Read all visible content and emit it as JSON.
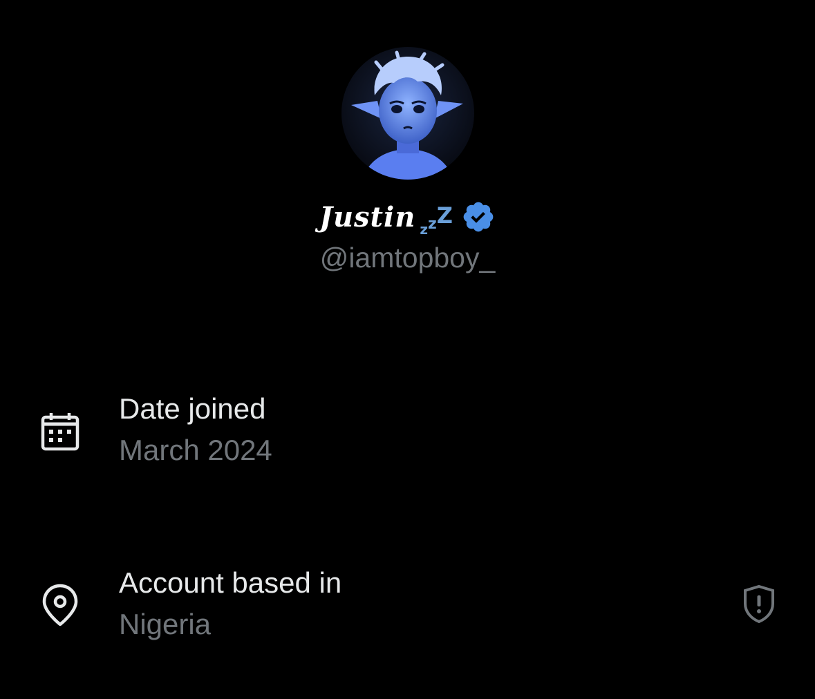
{
  "profile": {
    "display_name": "Justin",
    "name_suffix_emoji": [
      "z",
      "z",
      "Z"
    ],
    "handle": "@iamtopboy_",
    "verified": true,
    "avatar_icon": "avatar-illustration",
    "verified_color": "#4a8fe7"
  },
  "info": {
    "date_joined": {
      "label": "Date joined",
      "value": "March 2024",
      "icon": "calendar-icon"
    },
    "account_location": {
      "label": "Account based in",
      "value": "Nigeria",
      "icon": "location-pin-icon",
      "trailing_icon": "shield-alert-icon"
    }
  },
  "colors": {
    "background": "#000000",
    "primary_text": "#e7e9ea",
    "secondary_text": "#71767b",
    "accent": "#6a9fd8"
  }
}
